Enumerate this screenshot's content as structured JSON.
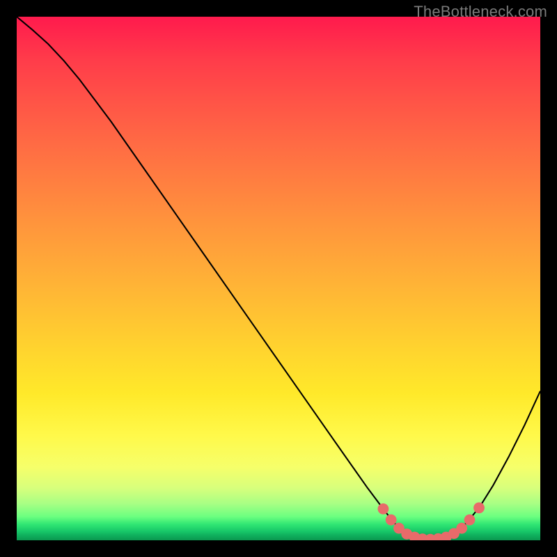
{
  "watermark": "TheBottleneck.com",
  "chart_data": {
    "type": "line",
    "title": "",
    "xlabel": "",
    "ylabel": "",
    "xlim": [
      0,
      100
    ],
    "ylim": [
      0,
      100
    ],
    "series": [
      {
        "name": "curve",
        "color": "#000000",
        "points": [
          {
            "x": 0.0,
            "y": 100.0
          },
          {
            "x": 3.0,
            "y": 97.5
          },
          {
            "x": 6.0,
            "y": 94.8
          },
          {
            "x": 9.0,
            "y": 91.6
          },
          {
            "x": 12.0,
            "y": 88.0
          },
          {
            "x": 18.0,
            "y": 80.0
          },
          {
            "x": 25.0,
            "y": 70.0
          },
          {
            "x": 35.0,
            "y": 55.7
          },
          {
            "x": 45.0,
            "y": 41.4
          },
          {
            "x": 55.0,
            "y": 27.1
          },
          {
            "x": 62.0,
            "y": 17.1
          },
          {
            "x": 67.0,
            "y": 10.0
          },
          {
            "x": 70.0,
            "y": 6.0
          },
          {
            "x": 72.0,
            "y": 3.4
          },
          {
            "x": 74.0,
            "y": 1.6
          },
          {
            "x": 76.0,
            "y": 0.6
          },
          {
            "x": 78.0,
            "y": 0.2
          },
          {
            "x": 80.0,
            "y": 0.2
          },
          {
            "x": 82.0,
            "y": 0.6
          },
          {
            "x": 84.0,
            "y": 1.6
          },
          {
            "x": 86.0,
            "y": 3.4
          },
          {
            "x": 88.5,
            "y": 6.5
          },
          {
            "x": 91.0,
            "y": 10.5
          },
          {
            "x": 94.0,
            "y": 16.0
          },
          {
            "x": 97.0,
            "y": 22.0
          },
          {
            "x": 100.0,
            "y": 28.5
          }
        ]
      },
      {
        "name": "bottleneck-markers",
        "color": "#e86a6a",
        "marker_radius": 1.05,
        "points": [
          {
            "x": 70.0,
            "y": 6.0
          },
          {
            "x": 71.5,
            "y": 3.9
          },
          {
            "x": 73.0,
            "y": 2.3
          },
          {
            "x": 74.5,
            "y": 1.2
          },
          {
            "x": 76.0,
            "y": 0.6
          },
          {
            "x": 77.5,
            "y": 0.25
          },
          {
            "x": 79.0,
            "y": 0.18
          },
          {
            "x": 80.5,
            "y": 0.3
          },
          {
            "x": 82.0,
            "y": 0.6
          },
          {
            "x": 83.5,
            "y": 1.3
          },
          {
            "x": 85.0,
            "y": 2.3
          },
          {
            "x": 86.5,
            "y": 3.9
          },
          {
            "x": 88.3,
            "y": 6.2
          }
        ]
      }
    ]
  },
  "colors": {
    "background": "#000000",
    "curve": "#000000",
    "marker": "#e86a6a",
    "watermark": "#7a7a7a"
  }
}
